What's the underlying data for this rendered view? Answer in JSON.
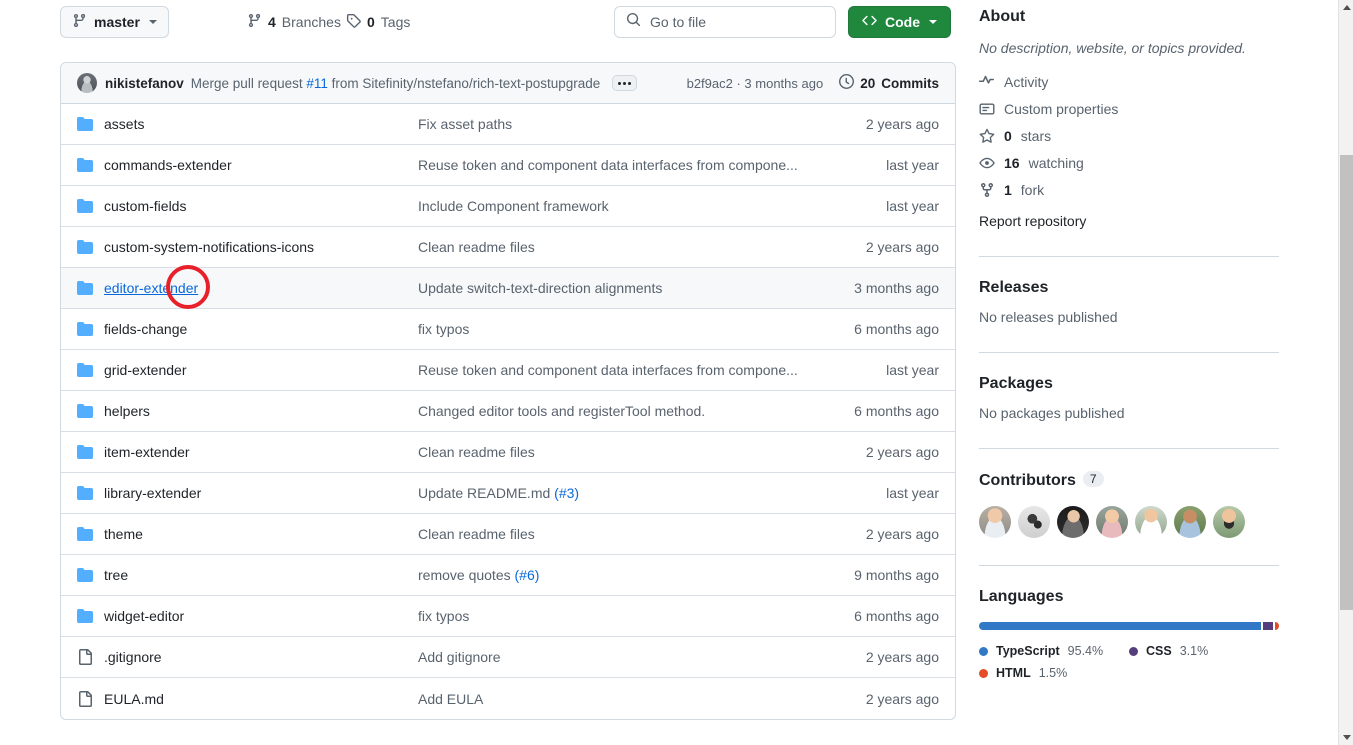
{
  "toolbar": {
    "branch": "master",
    "branches": {
      "count": "4",
      "label": "Branches"
    },
    "tags": {
      "count": "0",
      "label": "Tags"
    },
    "search_placeholder": "Go to file",
    "code_label": "Code"
  },
  "commit_bar": {
    "author": "nikistefanov",
    "message_prefix": "Merge pull request ",
    "pr_number": "#11",
    "message_suffix": " from Sitefinity/nstefano/rich-text-postupgrade",
    "sha": "b2f9ac2",
    "separator": " · ",
    "relative_time": "3 months ago",
    "commits_count": "20",
    "commits_label": "Commits"
  },
  "files": [
    {
      "icon": "folder-icon",
      "name": "assets",
      "commit": "Fix asset paths",
      "age": "2 years ago",
      "hovered": false
    },
    {
      "icon": "folder-icon",
      "name": "commands-extender",
      "commit": "Reuse token and component data interfaces from compone...",
      "age": "last year",
      "hovered": false
    },
    {
      "icon": "folder-icon",
      "name": "custom-fields",
      "commit": "Include Component framework",
      "age": "last year",
      "hovered": false
    },
    {
      "icon": "folder-icon",
      "name": "custom-system-notifications-icons",
      "commit": "Clean readme files",
      "age": "2 years ago",
      "hovered": false
    },
    {
      "icon": "folder-icon",
      "name": "editor-extender",
      "commit": "Update switch-text-direction alignments",
      "age": "3 months ago",
      "hovered": true
    },
    {
      "icon": "folder-icon",
      "name": "fields-change",
      "commit": "fix typos",
      "age": "6 months ago",
      "hovered": false
    },
    {
      "icon": "folder-icon",
      "name": "grid-extender",
      "commit": "Reuse token and component data interfaces from compone...",
      "age": "last year",
      "hovered": false
    },
    {
      "icon": "folder-icon",
      "name": "helpers",
      "commit": "Changed editor tools and registerTool method.",
      "age": "6 months ago",
      "hovered": false
    },
    {
      "icon": "folder-icon",
      "name": "item-extender",
      "commit": "Clean readme files",
      "age": "2 years ago",
      "hovered": false
    },
    {
      "icon": "folder-icon",
      "name": "library-extender",
      "commit": "Update README.md ",
      "commit_link": "(#3)",
      "age": "last year",
      "hovered": false
    },
    {
      "icon": "folder-icon",
      "name": "theme",
      "commit": "Clean readme files",
      "age": "2 years ago",
      "hovered": false
    },
    {
      "icon": "folder-icon",
      "name": "tree",
      "commit": "remove quotes ",
      "commit_link": "(#6)",
      "age": "9 months ago",
      "hovered": false
    },
    {
      "icon": "folder-icon",
      "name": "widget-editor",
      "commit": "fix typos",
      "age": "6 months ago",
      "hovered": false
    },
    {
      "icon": "file-icon",
      "name": ".gitignore",
      "commit": "Add gitignore",
      "age": "2 years ago",
      "hovered": false
    },
    {
      "icon": "file-icon",
      "name": "EULA.md",
      "commit": "Add EULA",
      "age": "2 years ago",
      "hovered": false
    }
  ],
  "about": {
    "heading": "About",
    "description": "No description, website, or topics provided.",
    "items": [
      {
        "icon": "activity-icon",
        "count": "",
        "label": "Activity"
      },
      {
        "icon": "custom-properties-icon",
        "count": "",
        "label": "Custom properties"
      },
      {
        "icon": "star-icon",
        "count": "0",
        "label": "stars"
      },
      {
        "icon": "eye-icon",
        "count": "16",
        "label": "watching"
      },
      {
        "icon": "fork-icon",
        "count": "1",
        "label": "fork"
      }
    ],
    "report_label": "Report repository"
  },
  "releases": {
    "heading": "Releases",
    "empty": "No releases published"
  },
  "packages": {
    "heading": "Packages",
    "empty": "No packages published"
  },
  "contributors": {
    "heading": "Contributors",
    "count": "7"
  },
  "languages": {
    "heading": "Languages",
    "items": [
      {
        "name": "TypeScript",
        "percent": "95.4%",
        "color": "#3178c6",
        "width": 95.4
      },
      {
        "name": "CSS",
        "percent": "3.1%",
        "color": "#563d7c",
        "width": 3.1
      },
      {
        "name": "HTML",
        "percent": "1.5%",
        "color": "#e34c26",
        "width": 1.5
      }
    ]
  },
  "annotation": {
    "shape": "circle",
    "color": "#e8202a",
    "target": "editor-extender"
  }
}
